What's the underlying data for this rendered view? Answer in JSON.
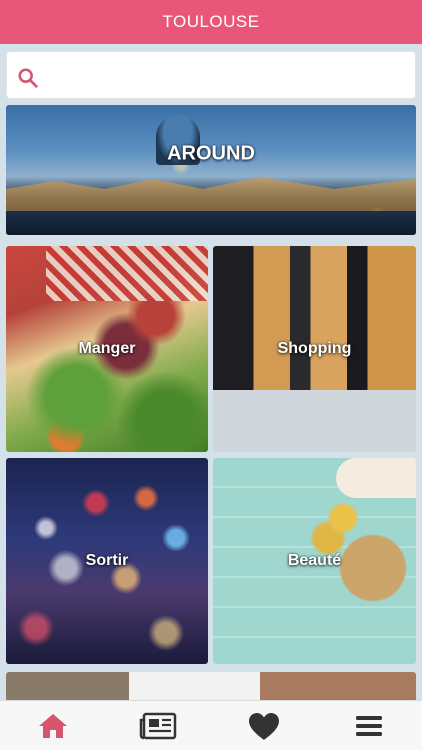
{
  "header": {
    "title": "TOULOUSE"
  },
  "search": {
    "placeholder": "",
    "value": ""
  },
  "tiles": [
    {
      "label": "AROUND"
    },
    {
      "label": "Manger"
    },
    {
      "label": "Shopping"
    },
    {
      "label": "Sortir"
    },
    {
      "label": "Beauté"
    }
  ],
  "nav": {
    "items": [
      {
        "icon": "home-icon"
      },
      {
        "icon": "newspaper-icon"
      },
      {
        "icon": "heart-icon"
      },
      {
        "icon": "menu-icon"
      }
    ]
  },
  "colors": {
    "accent": "#e8577a",
    "home_active": "#d8556f",
    "nav_icon": "#333333"
  }
}
